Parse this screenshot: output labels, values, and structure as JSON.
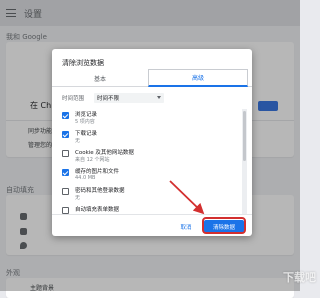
{
  "app": {
    "title": "设置"
  },
  "background": {
    "section_you_and_google": "我和 Google",
    "profile_text": "在 Chro",
    "rows": [
      "同步功能",
      "管理您的",
      "Chrome 浏览"
    ],
    "section_autofill": "自动填充",
    "section_privacy": "隐私设置",
    "section_search": "外观",
    "section_bottom": "外观",
    "bottom_item": "主题背景"
  },
  "dialog": {
    "title": "清除浏览数据",
    "tabs": [
      {
        "label": "基本",
        "active": false
      },
      {
        "label": "高级",
        "active": true
      }
    ],
    "time_range": {
      "label": "时间范围",
      "value": "时间不限"
    },
    "options": [
      {
        "name": "浏览记录",
        "sub": "5 项内容",
        "checked": true
      },
      {
        "name": "下载记录",
        "sub": "无",
        "checked": true
      },
      {
        "name": "Cookie 及其他网站数据",
        "sub": "来自 12 个网站",
        "checked": false
      },
      {
        "name": "缓存的图片和文件",
        "sub": "44.0 MB",
        "checked": true
      },
      {
        "name": "密码和其他登录数据",
        "sub": "无",
        "checked": false
      },
      {
        "name": "自动填充表单数据",
        "sub": "",
        "checked": false
      }
    ],
    "cancel_label": "取消",
    "clear_label": "清除数据"
  },
  "colors": {
    "accent": "#1a73e8",
    "highlight": "#d32f2f"
  },
  "watermark": "下载吧"
}
